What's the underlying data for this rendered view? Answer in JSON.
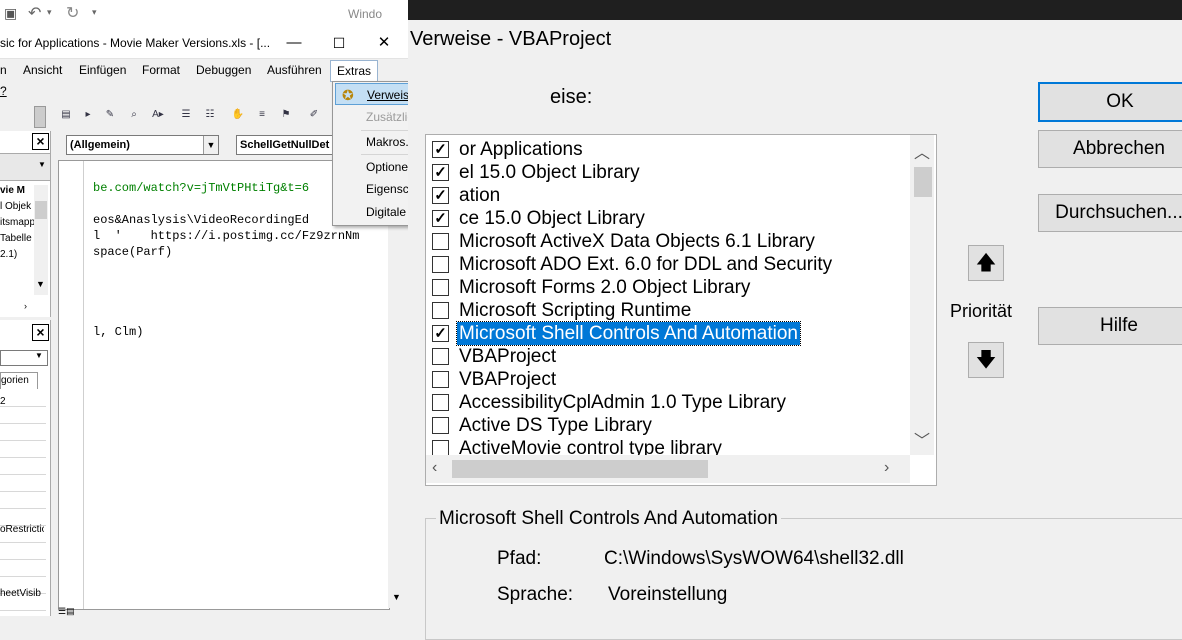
{
  "vbe": {
    "qat_right": "Windo",
    "title": "sic for Applications - Movie Maker Versions.xls - [...",
    "window_controls": [
      "—",
      "☐",
      "✕"
    ],
    "menus": [
      "n",
      "Ansicht",
      "Einfügen",
      "Format",
      "Debuggen",
      "Ausführen",
      "Extras"
    ],
    "help_mark": "?",
    "project_tree": [
      "vie M",
      "l Objek",
      "itsmapp",
      "Tabelle",
      "2.1)"
    ],
    "props_tab": "gorien",
    "props_rows": [
      "2",
      "oRestrictio",
      "heetVisib"
    ],
    "combo_object": "(Allgemein)",
    "combo_proc": "SchellGetNullDet",
    "code_lines": [
      {
        "text": "be.com/watch?v=jTmVtPHtiTg&t=6",
        "color": "#008000"
      },
      {
        "text": "",
        "color": "#000"
      },
      {
        "text": "eos&Anaslysis\\VideoRecordingEd",
        "color": "#000"
      },
      {
        "text": "l  '    https://i.postimg.cc/Fz9zrnNm",
        "color": "#000"
      },
      {
        "text": "space(Parf)",
        "color": "#000"
      },
      {
        "text": "",
        "color": "#000"
      },
      {
        "text": "",
        "color": "#000"
      },
      {
        "text": "",
        "color": "#000"
      },
      {
        "text": "",
        "color": "#000"
      },
      {
        "text": "l, Clm)",
        "color": "#000"
      }
    ]
  },
  "extras_menu": {
    "items": [
      {
        "label": "Verweise...",
        "state": "selected"
      },
      {
        "label": "Zusätzliche Steuerelemente...",
        "state": "disabled"
      },
      {
        "label": "Makros...",
        "state": "normal"
      },
      {
        "label": "Optionen...",
        "state": "normal"
      },
      {
        "label": "Eigenschaften von VBAProject...",
        "state": "normal"
      },
      {
        "label": "Digitale Signatur...",
        "state": "normal"
      }
    ]
  },
  "dialog": {
    "title": "Verweise - VBAProject",
    "available_label": "eise:",
    "references": [
      {
        "name": "or Applications",
        "checked": true,
        "selected": false
      },
      {
        "name": "el 15.0 Object Library",
        "checked": true,
        "selected": false
      },
      {
        "name": "ation",
        "checked": true,
        "selected": false
      },
      {
        "name": "ce 15.0 Object Library",
        "checked": true,
        "selected": false
      },
      {
        "name": "Microsoft ActiveX Data Objects 6.1 Library",
        "checked": false,
        "selected": false
      },
      {
        "name": "Microsoft ADO Ext. 6.0 for DDL and Security",
        "checked": false,
        "selected": false
      },
      {
        "name": "Microsoft Forms 2.0 Object Library",
        "checked": false,
        "selected": false
      },
      {
        "name": "Microsoft Scripting Runtime",
        "checked": false,
        "selected": false
      },
      {
        "name": "Microsoft Shell Controls And Automation",
        "checked": true,
        "selected": true
      },
      {
        "name": "VBAProject",
        "checked": false,
        "selected": false
      },
      {
        "name": "VBAProject",
        "checked": false,
        "selected": false
      },
      {
        "name": "AccessibilityCplAdmin 1.0 Type Library",
        "checked": false,
        "selected": false
      },
      {
        "name": "Active DS Type Library",
        "checked": false,
        "selected": false
      },
      {
        "name": "ActiveMovie control type library",
        "checked": false,
        "selected": false
      }
    ],
    "buttons": {
      "ok": "OK",
      "cancel": "Abbrechen",
      "browse": "Durchsuchen...",
      "help": "Hilfe"
    },
    "priority_label": "Priorität",
    "info": {
      "legend": "Microsoft Shell Controls And Automation",
      "path_label": "Pfad:",
      "path_value": "C:\\Windows\\SysWOW64\\shell32.dll",
      "lang_label": "Sprache:",
      "lang_value": "Voreinstellung"
    }
  }
}
